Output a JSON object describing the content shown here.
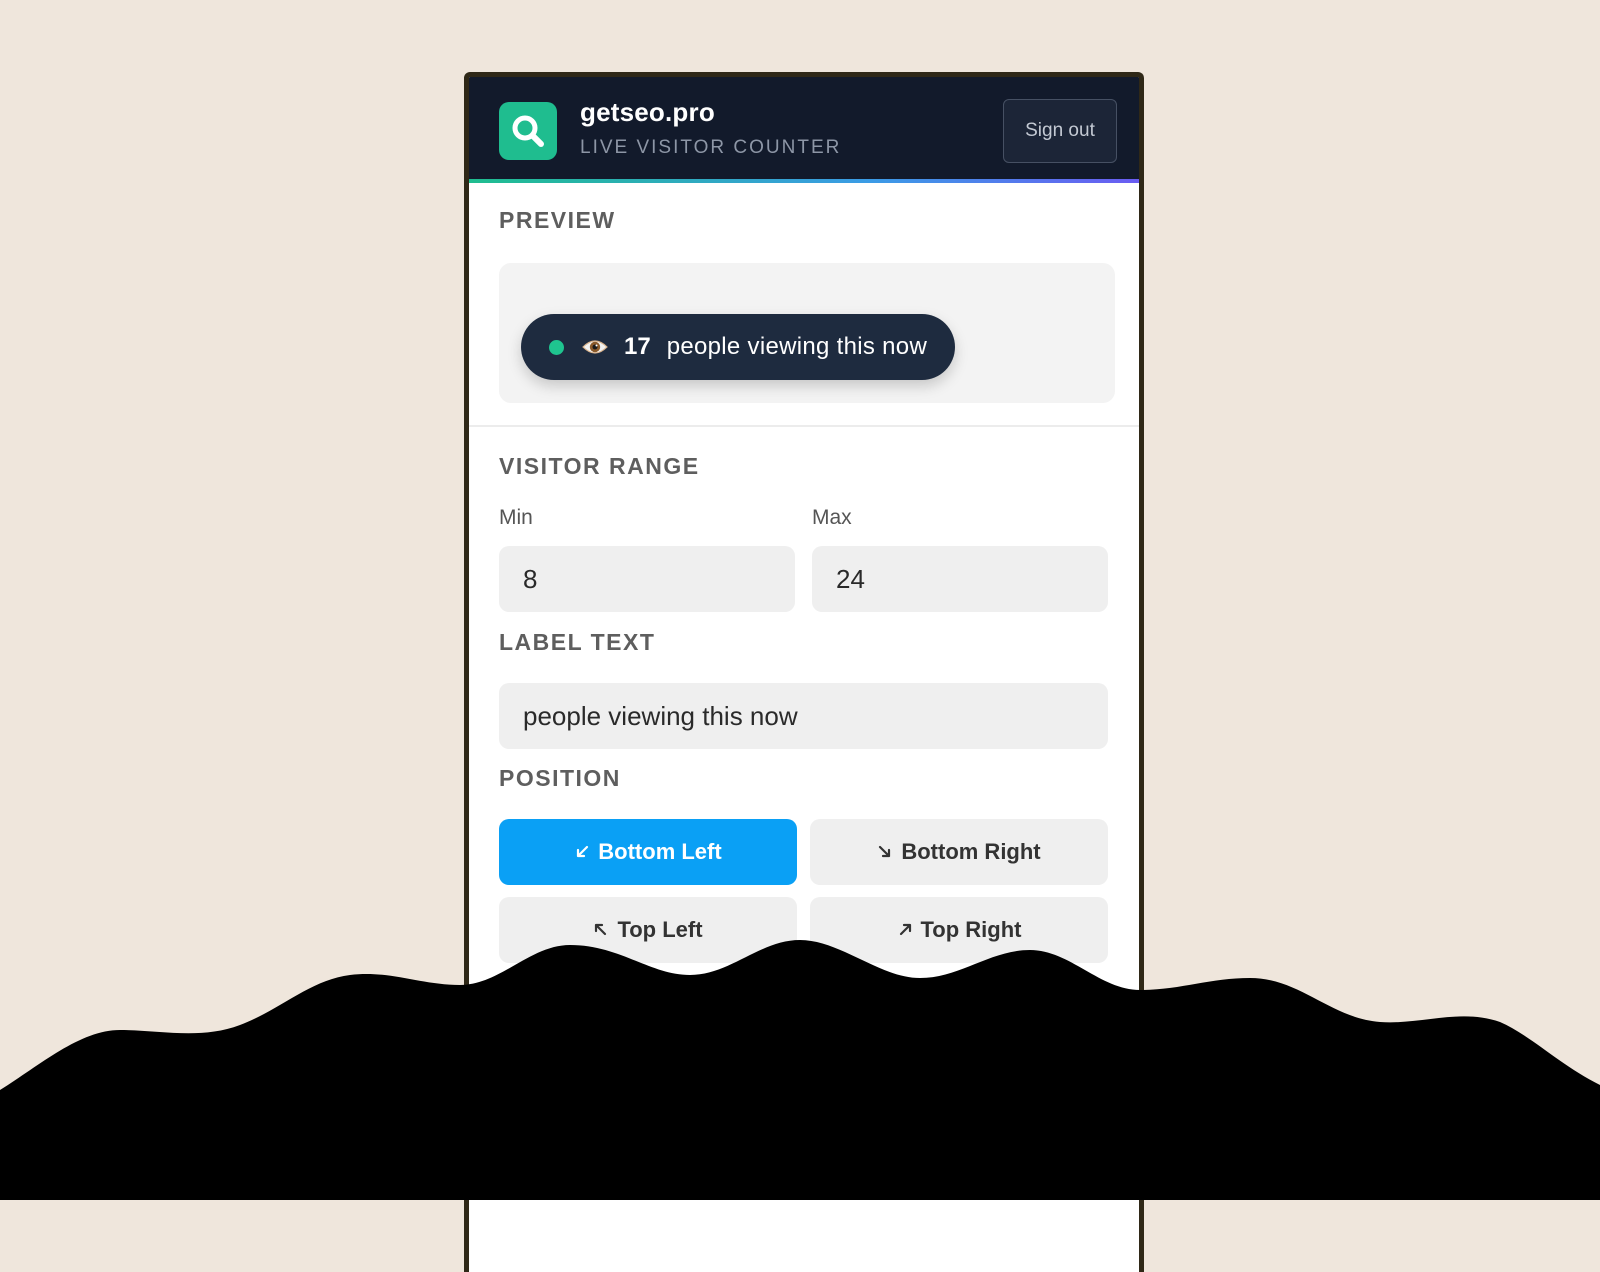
{
  "header": {
    "brand": "getseo.pro",
    "subtitle": "LIVE VISITOR COUNTER",
    "sign_out_label": "Sign out",
    "logo_icon": "search-icon",
    "accent": "#1fbd8f"
  },
  "preview": {
    "section_label": "PREVIEW",
    "count": "17",
    "text": "people viewing this now",
    "eye_icon": "eye-icon"
  },
  "visitor_range": {
    "section_label": "VISITOR RANGE",
    "min_label": "Min",
    "min_value": "8",
    "max_label": "Max",
    "max_value": "24"
  },
  "label_text": {
    "section_label": "LABEL TEXT",
    "value": "people viewing this now"
  },
  "position": {
    "section_label": "POSITION",
    "options": [
      {
        "label": "Bottom Left",
        "active": true
      },
      {
        "label": "Bottom Right",
        "active": false
      },
      {
        "label": "Top Left",
        "active": false
      },
      {
        "label": "Top Right",
        "active": false
      }
    ],
    "active_color": "#0aa0f5"
  }
}
